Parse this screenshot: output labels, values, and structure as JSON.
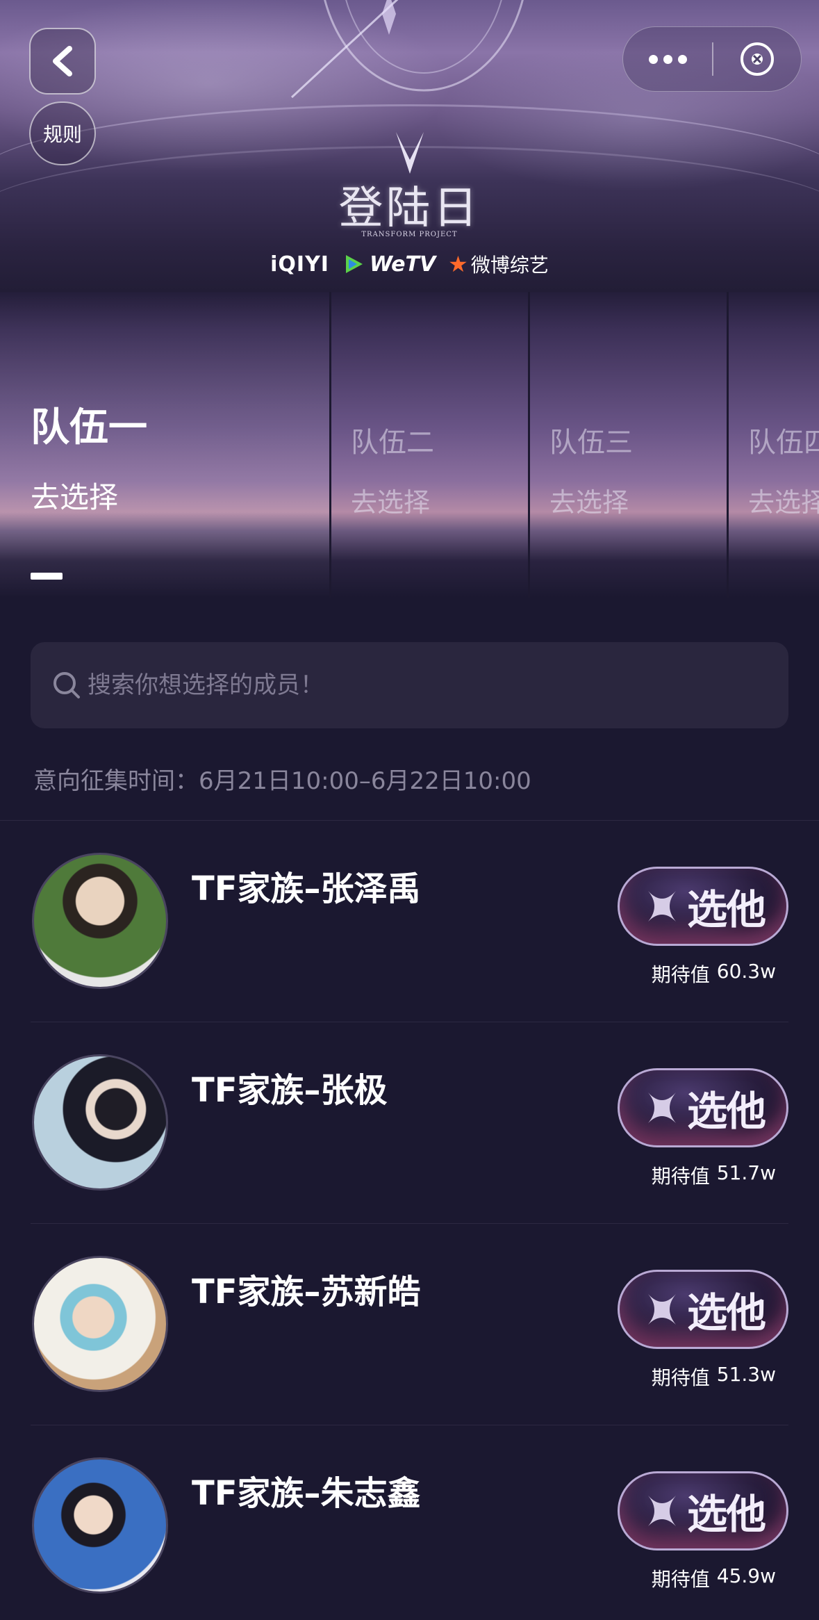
{
  "brand": {
    "title": "登陆日",
    "subtitle": "TRANSFORM PROJECT",
    "partners": {
      "iqiyi": "iQIYI",
      "wetv": "WeTV",
      "weibo": "微博综艺"
    }
  },
  "nav": {
    "rules_label": "规则"
  },
  "tabs": [
    {
      "title": "队伍一",
      "action": "去选择"
    },
    {
      "title": "队伍二",
      "action": "去选择"
    },
    {
      "title": "队伍三",
      "action": "去选择"
    },
    {
      "title": "队伍四",
      "action": "去选择"
    }
  ],
  "search": {
    "placeholder": "搜索你想选择的成员！"
  },
  "collect_time": "意向征集时间：6月21日10:00–6月22日10:00",
  "members": [
    {
      "name": "TF家族–张泽禹",
      "button": "选他",
      "expect_label": "期待值",
      "expect_value": "60.3w",
      "avatar_bg": "#4f7a3a"
    },
    {
      "name": "TF家族–张极",
      "button": "选他",
      "expect_label": "期待值",
      "expect_value": "51.7w",
      "avatar_bg": "#9cb6c9"
    },
    {
      "name": "TF家族–苏新皓",
      "button": "选他",
      "expect_label": "期待值",
      "expect_value": "51.3w",
      "avatar_bg": "#c9a27a"
    },
    {
      "name": "TF家族–朱志鑫",
      "button": "选他",
      "expect_label": "期待值",
      "expect_value": "45.9w",
      "avatar_bg": "#3a6fc2"
    }
  ],
  "colors": {
    "page_bg": "#1b1830",
    "accent": "#b9a9d4"
  }
}
